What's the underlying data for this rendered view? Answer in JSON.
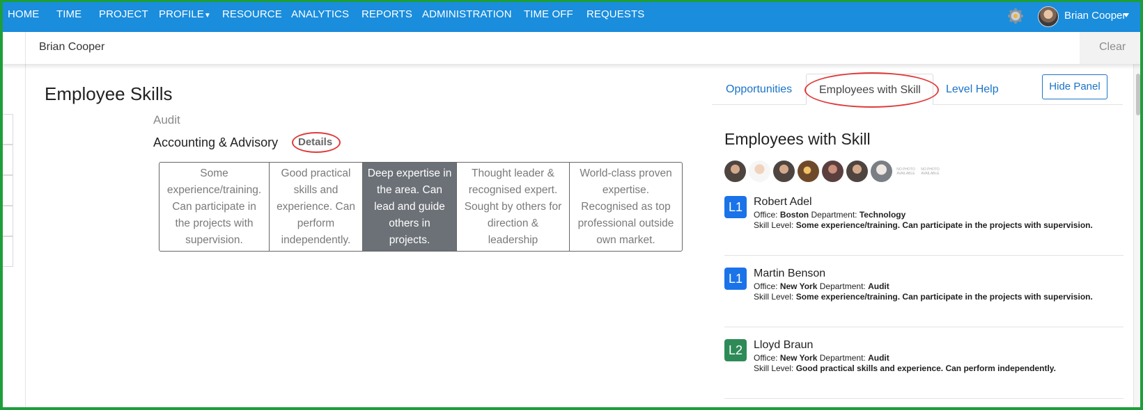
{
  "nav": {
    "items": [
      "HOME",
      "TIME",
      "PROJECT",
      "PROFILE",
      "RESOURCE",
      "ANALYTICS",
      "REPORTS",
      "ADMINISTRATION",
      "TIME OFF",
      "REQUESTS"
    ],
    "user_name": "Brian Cooper"
  },
  "search": {
    "value": "Brian Cooper",
    "clear_label": "Clear"
  },
  "page": {
    "title": "Employee Skills",
    "category": "Audit",
    "skill_name": "Accounting & Advisory",
    "details_label": "Details"
  },
  "levels": [
    "Some experience/training. Can participate in the projects with supervision.",
    "Good practical skills and experience. Can perform independently.",
    "Deep expertise in the area. Can lead and guide others in projects.",
    "Thought leader & recognised expert. Sought by others for direction & leadership",
    "World-class proven expertise. Recognised as top professional outside own market."
  ],
  "active_level_index": 2,
  "panel": {
    "tabs": [
      "Opportunities",
      "Employees with Skill",
      "Level Help"
    ],
    "active_tab": "Employees with Skill",
    "hide_label": "Hide Panel",
    "title": "Employees with Skill",
    "no_photo_text": "NO PHOTO AVAILABLE",
    "employees": [
      {
        "badge": "L1",
        "name": "Robert Adel",
        "office_label": "Office:",
        "office": "Boston",
        "dept_label": "Department:",
        "department": "Technology",
        "skill_label": "Skill Level:",
        "skill_level": "Some experience/training. Can participate in the projects with supervision."
      },
      {
        "badge": "L1",
        "name": "Martin Benson",
        "office_label": "Office:",
        "office": "New York",
        "dept_label": "Department:",
        "department": "Audit",
        "skill_label": "Skill Level:",
        "skill_level": "Some experience/training. Can participate in the projects with supervision."
      },
      {
        "badge": "L2",
        "name": "Lloyd Braun",
        "office_label": "Office:",
        "office": "New York",
        "dept_label": "Department:",
        "department": "Audit",
        "skill_label": "Skill Level:",
        "skill_level": "Good practical skills and experience. Can perform independently."
      }
    ]
  },
  "colors": {
    "nav_bg": "#1a8ddd",
    "link": "#1a73c9",
    "highlight": "#e03a3a",
    "active_level_bg": "#6b7177",
    "badge_l1": "#1a73e8",
    "badge_l2": "#2e8b57",
    "frame": "#1e9e3a"
  }
}
